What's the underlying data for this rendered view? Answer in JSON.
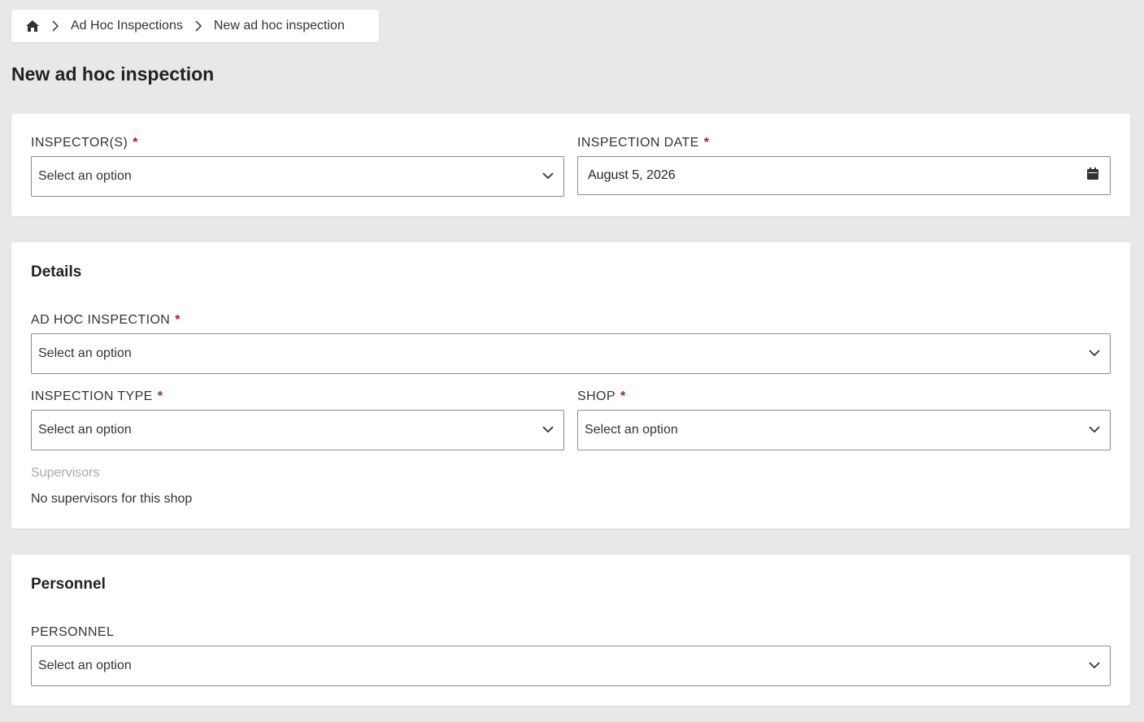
{
  "breadcrumb": {
    "home_icon": "home-icon",
    "items": [
      {
        "label": "Ad Hoc Inspections"
      },
      {
        "label": "New ad hoc inspection"
      }
    ]
  },
  "page": {
    "title": "New ad hoc inspection"
  },
  "header_card": {
    "inspectors": {
      "label": "INSPECTOR(S)",
      "required_mark": "*",
      "placeholder": "Select an option"
    },
    "inspection_date": {
      "label": "INSPECTION DATE",
      "required_mark": "*",
      "value": "August 5, 2026",
      "icon": "calendar-icon"
    }
  },
  "details": {
    "title": "Details",
    "ad_hoc_inspection": {
      "label": "AD HOC INSPECTION",
      "required_mark": "*",
      "placeholder": "Select an option"
    },
    "inspection_type": {
      "label": "INSPECTION TYPE",
      "required_mark": "*",
      "placeholder": "Select an option"
    },
    "shop": {
      "label": "SHOP",
      "required_mark": "*",
      "placeholder": "Select an option"
    },
    "supervisors": {
      "label": "Supervisors",
      "empty_text": "No supervisors for this shop"
    }
  },
  "personnel": {
    "title": "Personnel",
    "field": {
      "label": "PERSONNEL",
      "placeholder": "Select an option"
    }
  },
  "colors": {
    "background": "#e8e8e8",
    "card": "#ffffff",
    "required": "#b3161d",
    "border": "#8a8a8a",
    "muted": "#a8a8a8"
  }
}
